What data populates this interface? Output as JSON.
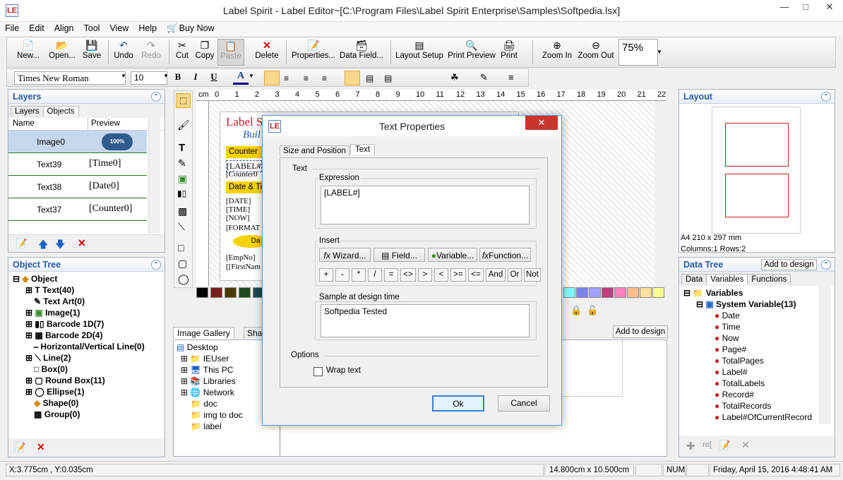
{
  "window": {
    "title": "Label Spirit - Label Editor~[C:\\Program Files\\Label Spirit Enterprise\\Samples\\Softpedia.lsx]"
  },
  "menu": [
    "File",
    "Edit",
    "Align",
    "Tool",
    "View",
    "Help",
    "Buy Now"
  ],
  "toolbar": {
    "new": "New...",
    "open": "Open...",
    "save": "Save",
    "undo": "Undo",
    "redo": "Redo",
    "cut": "Cut",
    "copy": "Copy",
    "paste": "Paste",
    "delete": "Delete",
    "properties": "Properties...",
    "data_field": "Data Field...",
    "layout_setup": "Layout Setup",
    "print_preview": "Print Preview",
    "print": "Print",
    "zoom_in": "Zoom In",
    "zoom_out": "Zoom Out",
    "zoom_value": "75%"
  },
  "format": {
    "font": "Times New Roman",
    "size": "10",
    "bold": "B",
    "italic": "I",
    "underline": "U",
    "color_a": "A"
  },
  "layers": {
    "title": "Layers",
    "tabs": [
      "Layers",
      "Objects"
    ],
    "columns": [
      "Name",
      "Preview"
    ],
    "rows": [
      {
        "name": "Image0",
        "preview": "100%"
      },
      {
        "name": "Text39",
        "preview": "[Time0]"
      },
      {
        "name": "Text38",
        "preview": "[Date0]"
      },
      {
        "name": "Text37",
        "preview": "[Counter0]"
      }
    ]
  },
  "object_tree": {
    "title": "Object Tree",
    "root": "Object",
    "items": [
      "Text(40)",
      "Text Art(0)",
      "Image(1)",
      "Barcode 1D(7)",
      "Barcode 2D(4)",
      "Horizontal/Vertical Line(0)",
      "Line(2)",
      "Box(0)",
      "Round Box(11)",
      "Ellipse(1)",
      "Shape(0)",
      "Group(0)"
    ]
  },
  "canvas": {
    "ruler_unit": "cm",
    "ruler_marks": [
      "0",
      "1",
      "2",
      "3",
      "4",
      "5",
      "6",
      "7",
      "8",
      "9",
      "10",
      "11",
      "12",
      "13",
      "14",
      "15",
      "16",
      "17",
      "18",
      "19",
      "20",
      "21",
      "22"
    ],
    "label_lines": [
      "Label S",
      "Buil",
      "Counter",
      "[LABEL#",
      "[Counter0",
      "Date & Ti",
      "[DATE]",
      "[TIME]",
      "[NOW]",
      "[FORMAT",
      "Da",
      "[EmpNo]",
      "[[FirstNam"
    ]
  },
  "gallery": {
    "tabs": [
      "Image Gallery",
      "Sha"
    ],
    "add_to_design": "Add to design",
    "items": [
      "Desktop",
      "IEUser",
      "This PC",
      "Libraries",
      "Network",
      "doc",
      "img to doc",
      "label"
    ]
  },
  "layout": {
    "title": "Layout",
    "paper": "A4 210 x 297 mm",
    "grid": "Columns:1 Rows:2"
  },
  "data_tree": {
    "title": "Data Tree",
    "add_to_design": "Add to design",
    "tabs": [
      "Data",
      "Variables",
      "Functions"
    ],
    "root": "Variables",
    "group": "System Variable(13)",
    "items": [
      "Date",
      "Time",
      "Now",
      "Page#",
      "TotalPages",
      "Label#",
      "TotalLabels",
      "Record#",
      "TotalRecords",
      "Label#OfCurrentRecord"
    ],
    "footer_text": "re["
  },
  "dialog": {
    "title": "Text Properties",
    "tabs": [
      "Size and Position",
      "Text"
    ],
    "section_text": "Text",
    "expression_label": "Expression",
    "expression_value": "[LABEL#]",
    "insert_label": "Insert",
    "wizard": "Wizard...",
    "field": "Field...",
    "variable": "Variable...",
    "function": "Function...",
    "operators": [
      "+",
      "-",
      "*",
      "/",
      "=",
      "<>",
      ">",
      "<",
      ">=",
      "<=",
      "And",
      "Or",
      "Not"
    ],
    "sample_label": "Sample at design time",
    "sample_value": "Softpedia Tested",
    "options_label": "Options",
    "wrap_text": "Wrap text",
    "ok": "Ok",
    "cancel": "Cancel"
  },
  "status": {
    "coords": "X:3.775cm , Y:0.035cm",
    "size": "14.800cm x 10.500cm",
    "num": "NUM",
    "datetime": "Friday, April 15, 2016 4:48:41 AM"
  },
  "colors": {
    "accent": "#2a5aa6",
    "row_border": "#1f7a1f",
    "label_red": "#c0202a",
    "yellow": "#f5d200",
    "dialog_border": "#5a9bd5"
  }
}
